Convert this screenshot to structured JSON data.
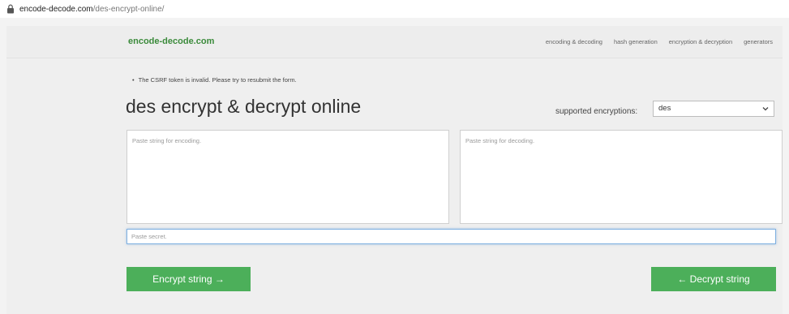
{
  "browser": {
    "url_host": "encode-decode.com",
    "url_path": "/des-encrypt-online/"
  },
  "header": {
    "logo": "encode-decode.com",
    "nav": [
      "encoding & decoding",
      "hash generation",
      "encryption & decryption",
      "generators"
    ]
  },
  "main": {
    "error": "The CSRF token is invalid. Please try to resubmit the form.",
    "title": "des encrypt & decrypt online",
    "encryption_label": "supported encryptions:",
    "encryption_selected": "des",
    "encode_placeholder": "Paste string for encoding.",
    "decode_placeholder": "Paste string for decoding.",
    "secret_placeholder": "Paste secret.",
    "encrypt_button": "Encrypt string →",
    "decrypt_button": "← Decrypt string"
  },
  "colors": {
    "accent": "#4caf5a",
    "logo": "#3a8a3a"
  },
  "icons": {
    "lock": "lock-icon",
    "dropdown": "chevron-down-icon"
  }
}
